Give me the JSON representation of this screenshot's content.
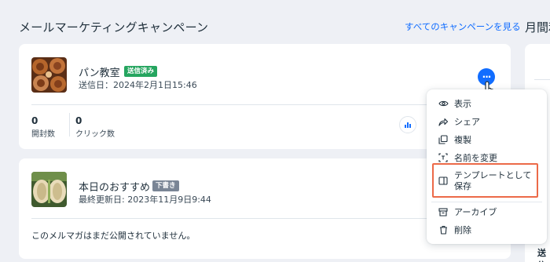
{
  "section": {
    "title": "メールマーケティングキャンペーン",
    "see_all": "すべてのキャンペーンを見る",
    "side_title": "月間利"
  },
  "side_panel": {
    "bottom_label": "送信"
  },
  "campaigns": [
    {
      "name": "パン教室",
      "status": "送信済み",
      "meta": "送信日：2024年2月1日15:46",
      "stats": [
        {
          "value": "0",
          "label": "開封数"
        },
        {
          "value": "0",
          "label": "クリック数"
        }
      ]
    },
    {
      "name": "本日のおすすめ",
      "status": "下書き",
      "meta": "最終更新日: 2023年11月9日9:44",
      "note": "このメルマガはまだ公開されていません。"
    }
  ],
  "more_button": {
    "label": "···"
  },
  "menu": {
    "items": [
      {
        "label": "表示",
        "icon": "eye-icon"
      },
      {
        "label": "シェア",
        "icon": "share-arrow-icon"
      },
      {
        "label": "複製",
        "icon": "duplicate-icon"
      },
      {
        "label": "名前を変更",
        "icon": "rename-icon"
      },
      {
        "label": "テンプレートとして保存",
        "icon": "save-template-icon"
      },
      {
        "label": "アーカイブ",
        "icon": "archive-icon"
      },
      {
        "label": "削除",
        "icon": "trash-icon"
      }
    ]
  },
  "colors": {
    "accent": "#116dff",
    "sent_badge": "#25a55f",
    "draft_badge": "#7a8595",
    "highlight": "#ec6a48"
  }
}
